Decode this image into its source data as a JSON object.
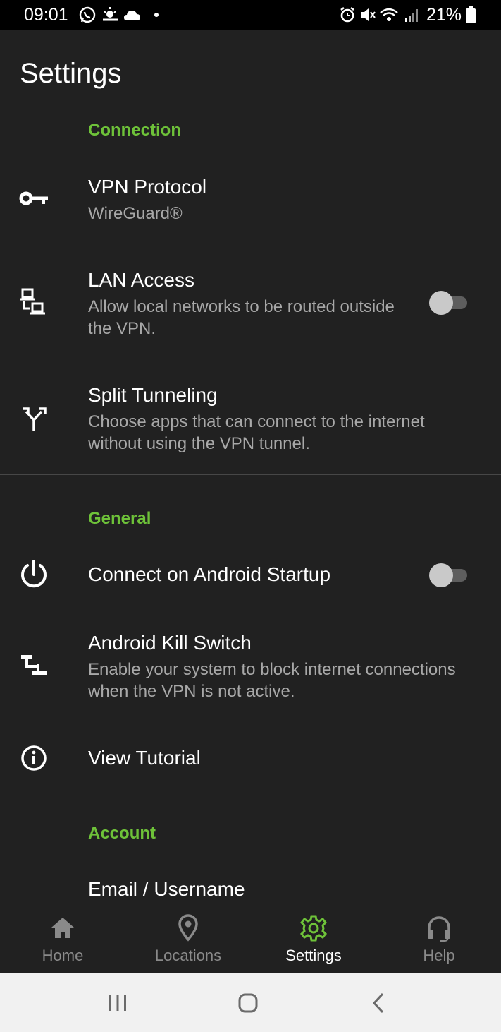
{
  "status_bar": {
    "time": "09:01",
    "battery": "21%"
  },
  "page": {
    "title": "Settings"
  },
  "sections": {
    "connection": {
      "header": "Connection",
      "vpn_protocol": {
        "title": "VPN Protocol",
        "value": "WireGuard®",
        "icon": "key-icon"
      },
      "lan_access": {
        "title": "LAN Access",
        "subtitle": "Allow local networks to be routed outside the VPN.",
        "enabled": false,
        "icon": "lan-icon"
      },
      "split_tunneling": {
        "title": "Split Tunneling",
        "subtitle": "Choose apps that can connect to the internet without using the VPN tunnel.",
        "icon": "split-icon"
      }
    },
    "general": {
      "header": "General",
      "connect_on_startup": {
        "title": "Connect on Android Startup",
        "enabled": false,
        "icon": "power-icon"
      },
      "kill_switch": {
        "title": "Android Kill Switch",
        "subtitle": "Enable your system to block internet connections when the VPN is not active.",
        "icon": "kill-switch-icon"
      },
      "view_tutorial": {
        "title": "View Tutorial",
        "icon": "info-icon"
      }
    },
    "account": {
      "header": "Account",
      "email": {
        "title": "Email / Username"
      }
    }
  },
  "bottom_nav": {
    "items": [
      {
        "label": "Home",
        "icon": "home-icon",
        "active": false
      },
      {
        "label": "Locations",
        "icon": "location-pin-icon",
        "active": false
      },
      {
        "label": "Settings",
        "icon": "gear-icon",
        "active": true
      },
      {
        "label": "Help",
        "icon": "headset-icon",
        "active": false
      }
    ]
  },
  "colors": {
    "accent": "#6ec239",
    "background": "#212121",
    "subtitle": "#a8a8a8",
    "nav_inactive": "#8a8a8a"
  }
}
